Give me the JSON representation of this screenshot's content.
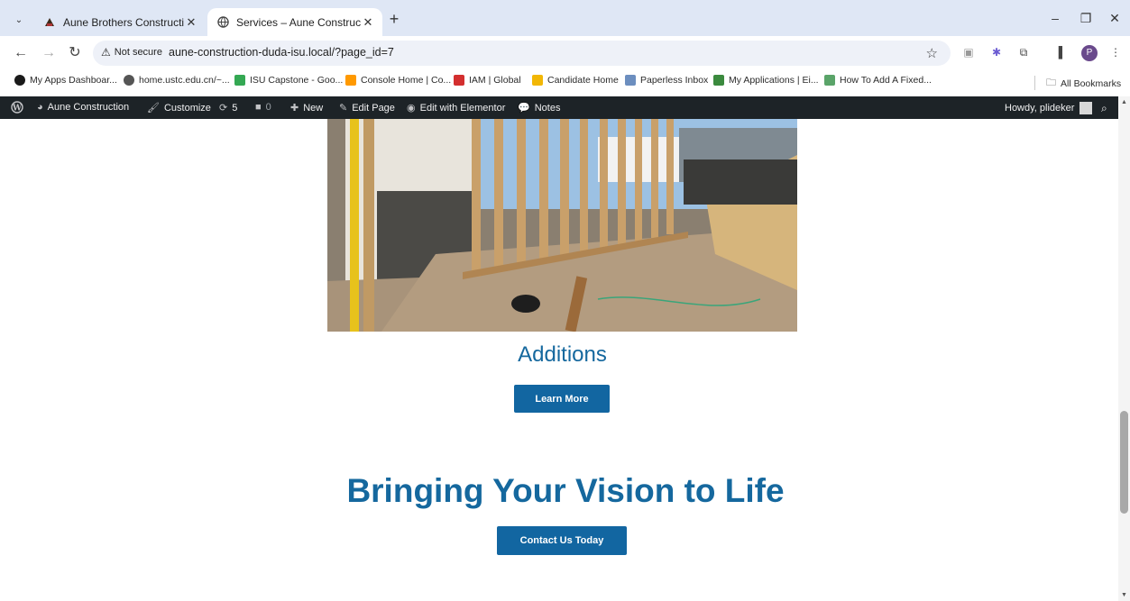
{
  "browser": {
    "tabs": [
      {
        "title": "Aune Brothers Construction",
        "active": false
      },
      {
        "title": "Services – Aune Construction",
        "active": true
      }
    ],
    "security_label": "Not secure",
    "url": "aune-construction-duda-isu.local/?page_id=7",
    "profile_initial": "P",
    "bookmarks": [
      {
        "label": "My Apps Dashboar...",
        "color": "#1a1a1a"
      },
      {
        "label": "home.ustc.edu.cn/~...",
        "color": "#555555"
      },
      {
        "label": "ISU Capstone - Goo...",
        "color": "#34a853"
      },
      {
        "label": "Console Home | Co...",
        "color": "#ff9900"
      },
      {
        "label": "IAM | Global",
        "color": "#d32f2f"
      },
      {
        "label": "Candidate Home",
        "color": "#f2b705"
      },
      {
        "label": "Paperless Inbox",
        "color": "#6c8ebf"
      },
      {
        "label": "My Applications | Ei...",
        "color": "#3b8a3e"
      },
      {
        "label": "How To Add A Fixed...",
        "color": "#5aa469"
      }
    ],
    "all_bookmarks_label": "All Bookmarks"
  },
  "adminbar": {
    "site_name": "Aune Construction",
    "customize": "Customize",
    "updates_count": "5",
    "comments_count": "0",
    "new_label": "New",
    "edit_page": "Edit Page",
    "edit_elementor": "Edit with Elementor",
    "notes": "Notes",
    "howdy": "Howdy, plideker"
  },
  "content": {
    "service_title": "Additions",
    "learn_more": "Learn More",
    "headline": "Bringing Your Vision to Life",
    "contact_button": "Contact Us Today"
  },
  "colors": {
    "brand_blue": "#15689e",
    "button_blue": "#1266a1",
    "admin_bar": "#1d2327"
  }
}
